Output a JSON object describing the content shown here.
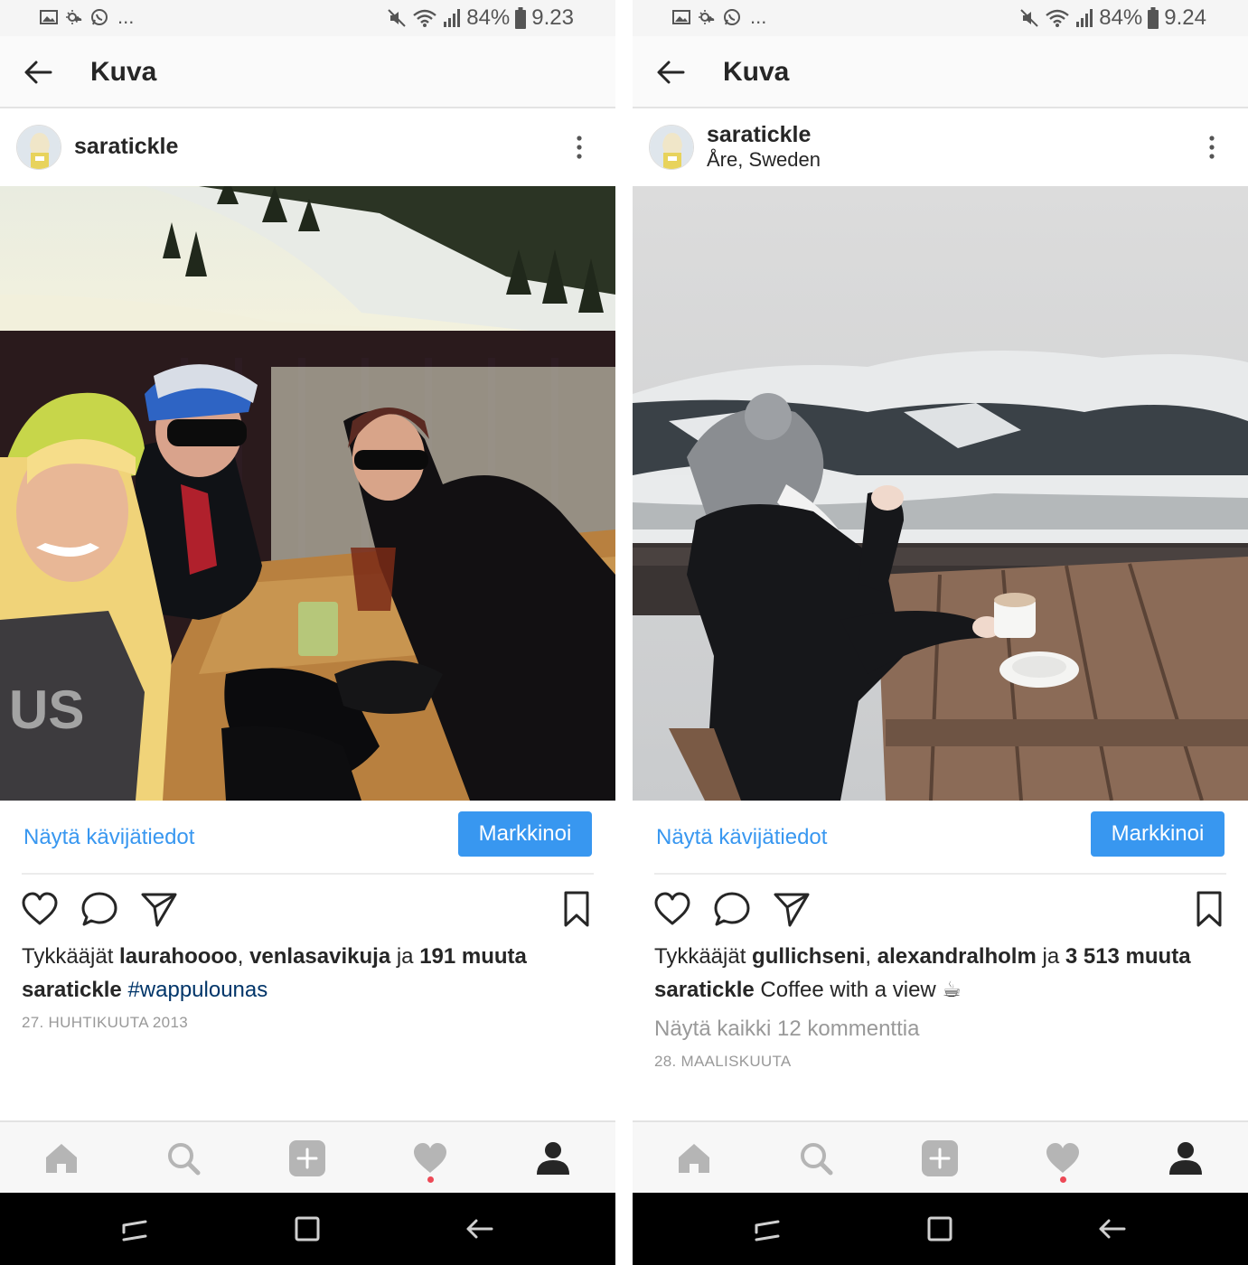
{
  "colors": {
    "accent": "#3897f0",
    "hashtag": "#003569",
    "notification": "#ed4956"
  },
  "screens": [
    {
      "status": {
        "battery": "84%",
        "time": "9.23",
        "more": "..."
      },
      "appbar": {
        "title": "Kuva"
      },
      "post": {
        "username": "saratickle",
        "location": "",
        "photo_alt": "",
        "insights_label": "Näytä kävijätiedot",
        "promote_label": "Markkinoi",
        "likes": {
          "prefix": "Tykkääjät ",
          "user1": "laurahoooo",
          "sep1": ", ",
          "user2": "venlasavikuja",
          "sep2": " ja ",
          "others": "191 muuta"
        },
        "caption": {
          "user": "saratickle",
          "text": "",
          "hashtag": "#wappulounas"
        },
        "comments_label": "",
        "date": "27. HUHTIKUUTA 2013"
      }
    },
    {
      "status": {
        "battery": "84%",
        "time": "9.24",
        "more": "..."
      },
      "appbar": {
        "title": "Kuva"
      },
      "post": {
        "username": "saratickle",
        "location": "Åre, Sweden",
        "insights_label": "Näytä kävijätiedot",
        "promote_label": "Markkinoi",
        "likes": {
          "prefix": "Tykkääjät ",
          "user1": "gullichseni",
          "sep1": ", ",
          "user2": "alexandralholm",
          "sep2": " ja ",
          "others": "3 513 muuta"
        },
        "caption": {
          "user": "saratickle",
          "text": " Coffee with a view ☕",
          "hashtag": ""
        },
        "comments_label": "Näytä kaikki 12 kommenttia",
        "date": "28. MAALISKUUTA"
      }
    }
  ],
  "icons": {
    "status_left": [
      "gallery-icon",
      "weather-icon",
      "whatsapp-icon"
    ],
    "status_right": [
      "mute-icon",
      "wifi-icon",
      "signal-icon",
      "battery-icon"
    ],
    "actions": [
      "heart-icon",
      "comment-icon",
      "share-icon",
      "bookmark-icon"
    ],
    "tabs": [
      "home-icon",
      "search-icon",
      "add-icon",
      "activity-icon",
      "profile-icon"
    ],
    "system_nav": [
      "recents-icon",
      "home-square-icon",
      "system-back-icon"
    ]
  }
}
